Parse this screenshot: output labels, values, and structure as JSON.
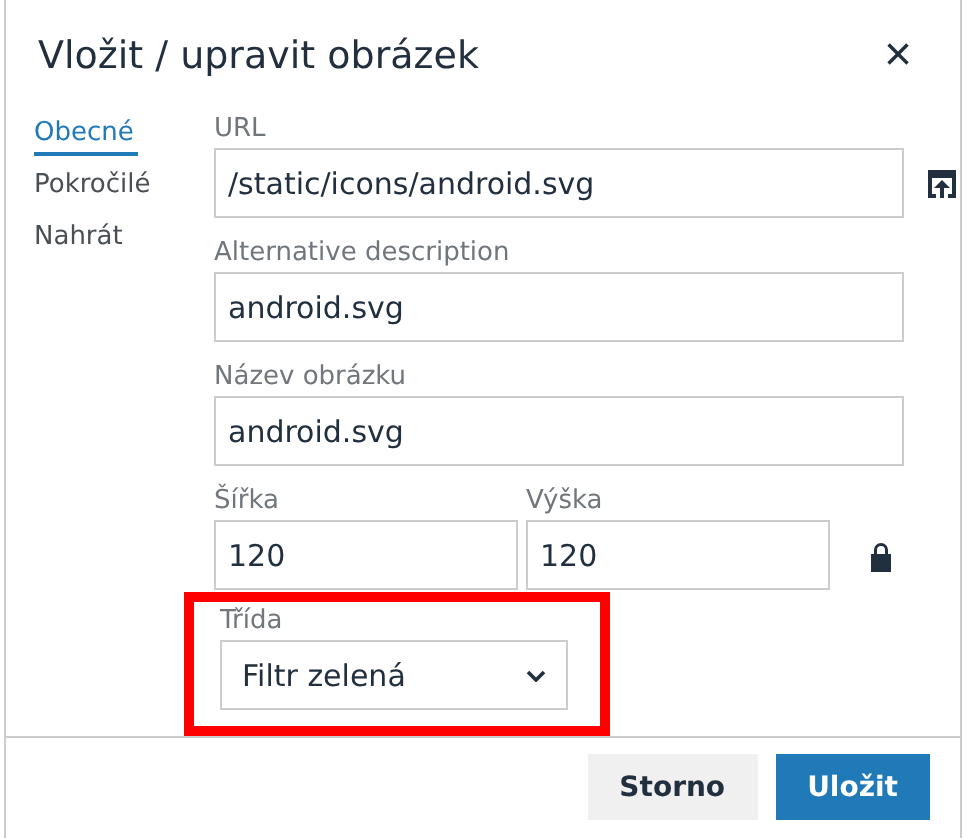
{
  "dialog": {
    "title": "Vložit / upravit obrázek",
    "close_icon": "×"
  },
  "tabs": [
    {
      "label": "Obecné",
      "selected": true
    },
    {
      "label": "Pokročilé",
      "selected": false
    },
    {
      "label": "Nahrát",
      "selected": false
    }
  ],
  "fields": {
    "url": {
      "label": "URL",
      "value": "/static/icons/android.svg"
    },
    "alt": {
      "label": "Alternative description",
      "value": "android.svg"
    },
    "title": {
      "label": "Název obrázku",
      "value": "android.svg"
    },
    "width": {
      "label": "Šířka",
      "value": "120"
    },
    "height": {
      "label": "Výška",
      "value": "120"
    },
    "constrain": {
      "locked": true
    },
    "class": {
      "label": "Třída",
      "value": "Filtr zelená",
      "highlighted": true
    }
  },
  "buttons": [
    {
      "label": "Storno",
      "kind": "secondary"
    },
    {
      "label": "Uložit",
      "kind": "primary"
    }
  ]
}
